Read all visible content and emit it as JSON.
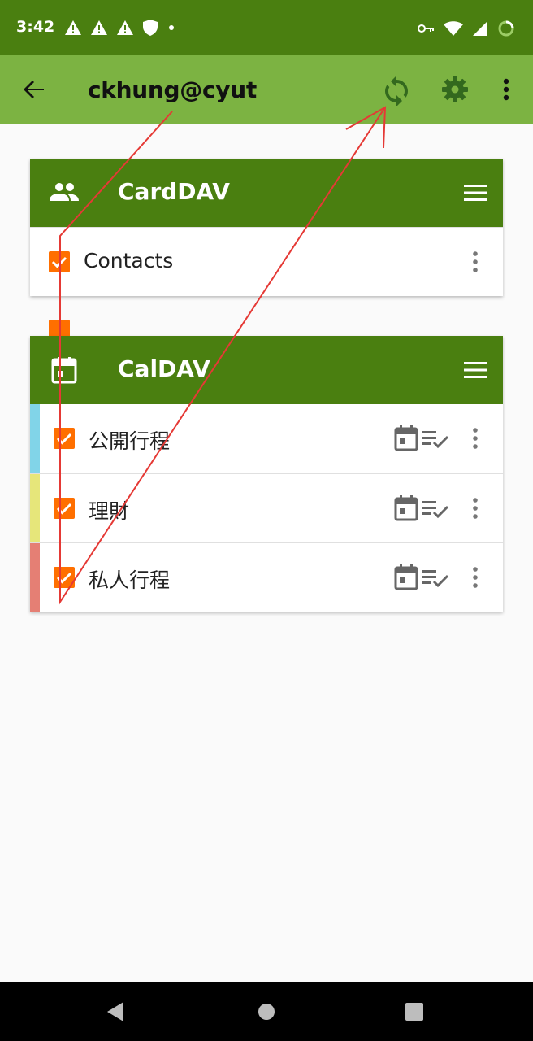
{
  "status_bar": {
    "time": "3:42",
    "left_icons": [
      "warning-icon",
      "warning-icon",
      "warning-icon",
      "shield-icon",
      "dot-icon"
    ],
    "right_icons": [
      "vpn-key-icon",
      "wifi-icon",
      "cell-signal-icon",
      "battery-charging-icon"
    ]
  },
  "app_bar": {
    "title": "ckhung@cyut",
    "actions": [
      "sync-icon",
      "settings-icon",
      "more-vert-icon"
    ]
  },
  "carddav": {
    "title": "CardDAV",
    "items": [
      {
        "label": "Contacts",
        "checked": true
      }
    ]
  },
  "caldav": {
    "title": "CalDAV",
    "items": [
      {
        "label": "公開行程",
        "checked": true,
        "color": "#81d4e8"
      },
      {
        "label": "理財",
        "checked": true,
        "color": "#e6e67a"
      },
      {
        "label": "私人行程",
        "checked": true,
        "color": "#e57f74"
      }
    ]
  },
  "colors": {
    "status_bar": "#4a7f10",
    "app_bar": "#7cb342",
    "card_header": "#4a7f10",
    "checkbox": "#ff6f00",
    "annotation": "#e53935"
  }
}
